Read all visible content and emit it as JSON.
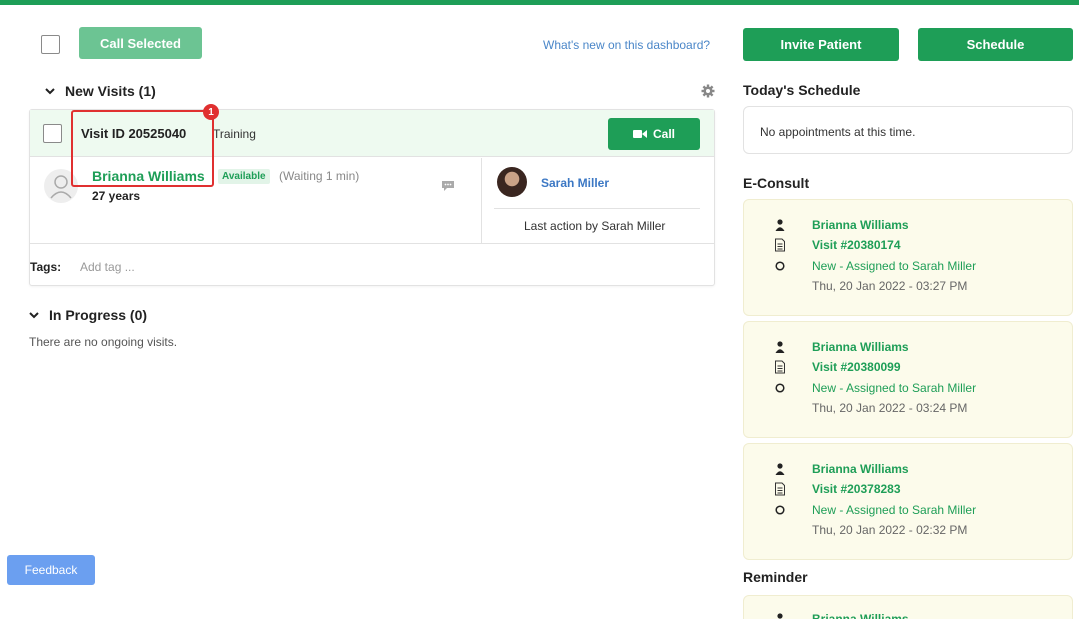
{
  "toolbar": {
    "call_selected_label": "Call Selected",
    "whats_new_label": "What's new on this dashboard?"
  },
  "new_visits": {
    "heading": "New Visits (1)",
    "visit": {
      "id_label": "Visit ID 20525040",
      "type": "Training",
      "call_label": "Call",
      "patient_name": "Brianna Williams",
      "availability": "Available",
      "waiting": "(Waiting 1 min)",
      "age": "27 years",
      "doctor_name": "Sarah Miller",
      "last_action": "Last action by Sarah Miller",
      "tags_label": "Tags:",
      "tags_placeholder": "Add tag ..."
    },
    "annotation_marker": "1"
  },
  "in_progress": {
    "heading": "In Progress (0)",
    "empty_text": "There are no ongoing visits."
  },
  "feedback_label": "Feedback",
  "right": {
    "invite_label": "Invite Patient",
    "schedule_label": "Schedule",
    "todays_schedule_heading": "Today's Schedule",
    "no_appointments": "No appointments at this time.",
    "econsult_heading": "E-Consult",
    "econsults": [
      {
        "name": "Brianna Williams",
        "visit": "Visit #20380174",
        "status": "New - Assigned to Sarah Miller",
        "date": "Thu, 20 Jan 2022 - 03:27 PM"
      },
      {
        "name": "Brianna Williams",
        "visit": "Visit #20380099",
        "status": "New - Assigned to Sarah Miller",
        "date": "Thu, 20 Jan 2022 - 03:24 PM"
      },
      {
        "name": "Brianna Williams",
        "visit": "Visit #20378283",
        "status": "New - Assigned to Sarah Miller",
        "date": "Thu, 20 Jan 2022 - 02:32 PM"
      }
    ],
    "reminder_heading": "Reminder",
    "reminder_name": "Brianna Williams"
  },
  "colors": {
    "brand_green": "#1e9e57",
    "link_blue": "#4a86c8",
    "highlight_red": "#e03030"
  }
}
